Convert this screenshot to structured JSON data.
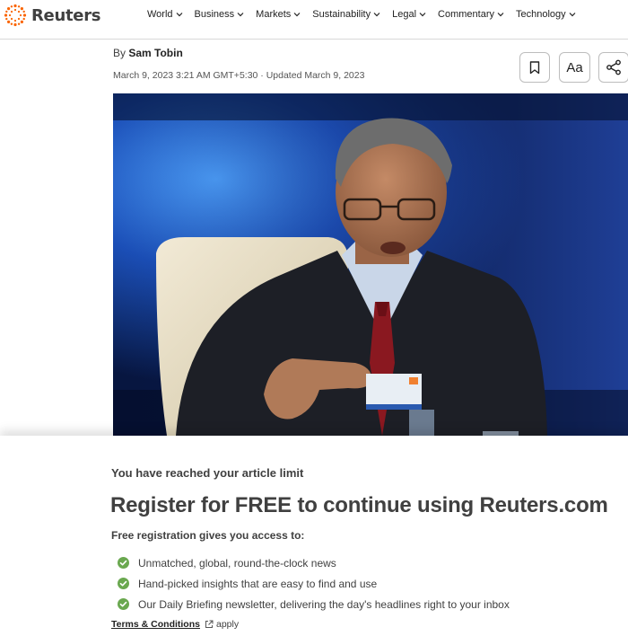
{
  "header": {
    "logo_text": "Reuters",
    "nav": [
      {
        "label": "World"
      },
      {
        "label": "Business"
      },
      {
        "label": "Markets"
      },
      {
        "label": "Sustainability"
      },
      {
        "label": "Legal"
      },
      {
        "label": "Commentary"
      },
      {
        "label": "Technology"
      }
    ]
  },
  "article": {
    "byline_prefix": "By",
    "author": "Sam Tobin",
    "dateline": "March 9, 2023 3:21 AM GMT+5:30 · Updated March 9, 2023",
    "text_size_label": "Aa"
  },
  "paywall": {
    "limit_text": "You have reached your article limit",
    "headline": "Register for FREE to continue using Reuters.com",
    "subtitle": "Free registration gives you access to:",
    "benefits": [
      "Unmatched, global, round-the-clock news",
      "Hand-picked insights that are easy to find and use",
      "Our Daily Briefing newsletter, delivering the day's headlines right to your inbox"
    ],
    "terms_link": "Terms & Conditions",
    "terms_suffix": "apply"
  },
  "colors": {
    "brand_orange": "#fa6400",
    "check_green": "#6aa84f",
    "text_dark": "#404040"
  },
  "icons": [
    "reuters-logo-icon",
    "chevron-down-icon",
    "bookmark-icon",
    "share-icon",
    "check-circle-icon",
    "external-link-icon"
  ]
}
